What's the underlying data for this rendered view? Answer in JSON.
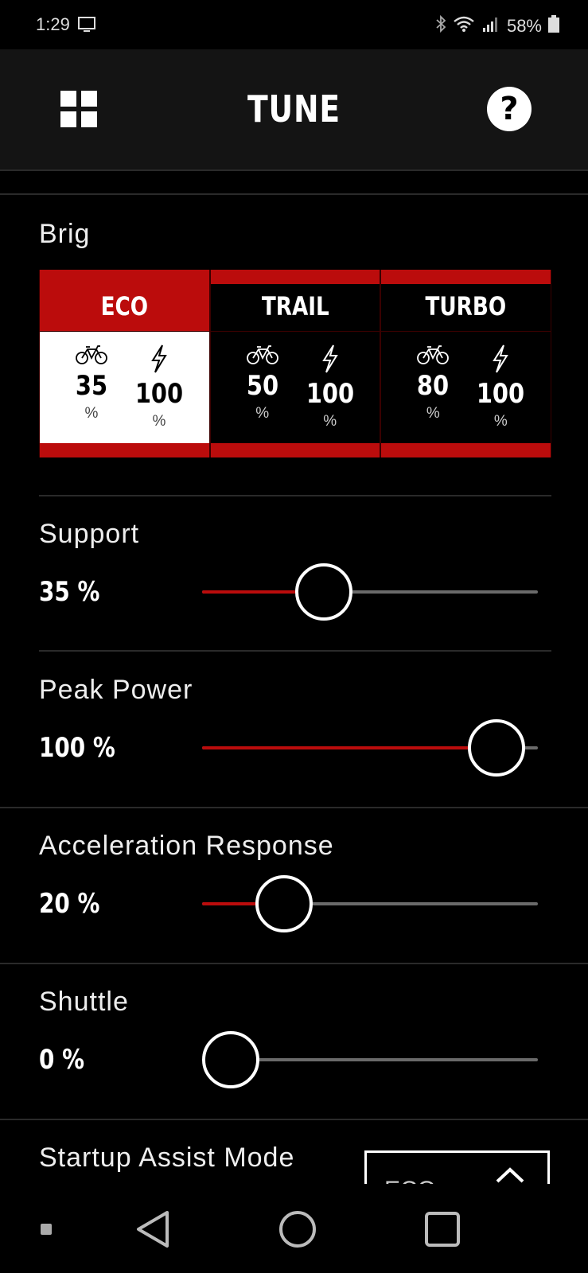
{
  "status_bar": {
    "time": "1:29",
    "battery": "58%"
  },
  "header": {
    "title": "TUNE",
    "help_label": "?"
  },
  "profile": {
    "name": "Brig"
  },
  "modes": [
    {
      "label": "ECO",
      "support": "35",
      "peak": "100",
      "unit": "%",
      "active": true
    },
    {
      "label": "TRAIL",
      "support": "50",
      "peak": "100",
      "unit": "%",
      "active": false
    },
    {
      "label": "TURBO",
      "support": "80",
      "peak": "100",
      "unit": "%",
      "active": false
    }
  ],
  "settings": {
    "support": {
      "title": "Support",
      "value_text": "35 %",
      "level": 0.35
    },
    "peak_power": {
      "title": "Peak Power",
      "value_text": "100 %",
      "level": 1.0
    },
    "acceleration": {
      "title": "Acceleration Response",
      "value_text": "20 %",
      "level": 0.2
    },
    "shuttle": {
      "title": "Shuttle",
      "value_text": "0 %",
      "level": 0.0
    }
  },
  "startup": {
    "title": "Startup Assist Mode",
    "selected": "ECO"
  },
  "colors": {
    "accent": "#bb0c0c",
    "background": "#000000",
    "track": "#6a6a6a"
  },
  "icons": {
    "grid": "grid-menu-icon",
    "bike": "bicycle-icon",
    "bolt": "lightning-bolt-icon",
    "nav_back": "triangle-back-icon",
    "nav_home": "circle-home-icon",
    "nav_recent": "square-recent-icon"
  }
}
